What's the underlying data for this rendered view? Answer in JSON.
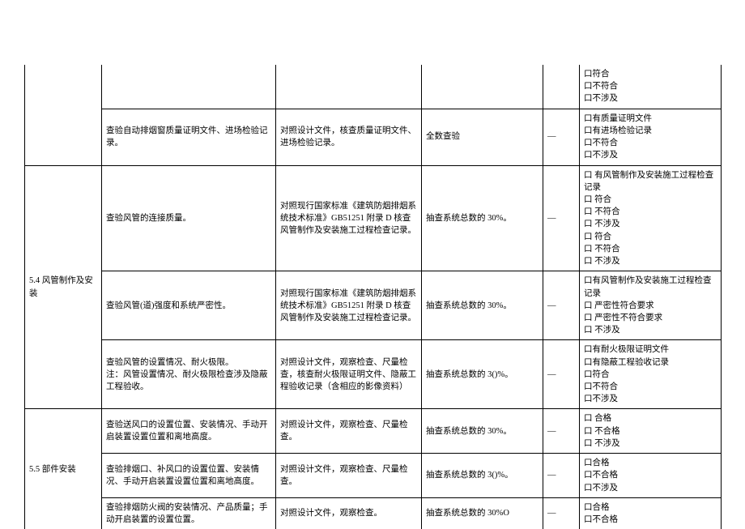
{
  "dash": "—",
  "row0": {
    "result": [
      "口符合",
      "口不符合",
      "口不涉及"
    ]
  },
  "row1": {
    "check": "查验自动排烟窗质量证明文件、进场检验记录。",
    "method": "对照设计文件，核查质量证明文件、进场检验记录。",
    "qty": "全数查验",
    "result": [
      "口有质量证明文件",
      "口有进场检验记录",
      "",
      "口不符合",
      "口不涉及"
    ]
  },
  "section54": "5.4 风管制作及安装",
  "row2": {
    "check": "查验风管的连接质量。",
    "method": "对照现行国家标准《建筑防烟排烟系统技术标准》GB51251 附录 D 核查风管制作及安装施工过程检查记录。",
    "qty": "抽查系统总数的 30%。",
    "result": [
      "口 有风管制作及安装施工过程检查记录",
      "口 符合",
      "口 不符合",
      "口 不涉及",
      "口 符合",
      "口 不符合",
      "口 不涉及"
    ]
  },
  "row3": {
    "check": "查验风管(道)强度和系统严密性。",
    "method": "对照现行国家标准《建筑防烟排烟系统技术标准》GB51251 附录 D 核查风管制作及安装施工过程检查记录。",
    "qty": "抽查系统总数的 30%。",
    "result": [
      "口有风管制作及安装施工过程检查记录",
      "口 严密性符合要求",
      "口 严密性不符合要求",
      "口 不涉及"
    ]
  },
  "row4": {
    "check": "查验风管的设置情况、耐火极限。\n注：风管设置情况、耐火极限检查涉及隐蔽工程验收。",
    "method": "对照设计文件，观察检查、尺量检查，核查耐火极限证明文件、隐蔽工程验收记录（含相应的影像资料）",
    "qty": "抽查系统总数的 3()%。",
    "result": [
      "口有耐火极限证明文件",
      "口有隐蔽工程验收记录",
      "口符合",
      "口不符合",
      "口不涉及"
    ]
  },
  "section55": "5.5 部件安装",
  "row5": {
    "check": "查验送风口的设置位置、安装情况、手动开启装置设置位置和离地高度。",
    "method": "对照设计文件，观察检查、尺量检查。",
    "qty": "抽查系统总数的 30%。",
    "result": [
      "口 合格",
      "口 不合格",
      "口 不涉及"
    ]
  },
  "row6": {
    "check": "查验排烟口、补风口的设置位置、安装情况、手动开启装置设置位置和离地高度。",
    "method": "对照设计文件，观察检查、尺量检查。",
    "qty": "抽查系统总数的 3()%。",
    "result": [
      "口合格",
      "口不合格",
      "口不涉及"
    ]
  },
  "row7": {
    "check": "查验排烟防火阀的安装情况、产品质量；手动开启装置的设置位置。",
    "method": "对照设计文件，观察检查。",
    "qty": "抽查系统总数的 30%O",
    "result": [
      "口合格",
      "口不合格"
    ]
  }
}
